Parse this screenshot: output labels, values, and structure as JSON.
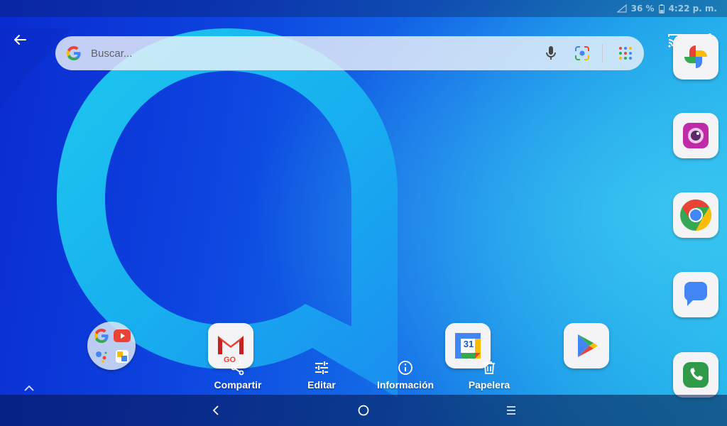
{
  "status_bar": {
    "battery_percent": "36 %",
    "time": "4:22 p. m."
  },
  "search": {
    "placeholder": "Buscar..."
  },
  "actions": {
    "share_label": "Compartir",
    "edit_label": "Editar",
    "info_label": "Información",
    "trash_label": "Papelera"
  },
  "gmail_badge": "GO",
  "calendar_day": "31",
  "icons": {
    "back": "arrow-left-icon",
    "cast": "cast-icon",
    "more": "more-vertical-icon",
    "mic": "mic-icon",
    "lens": "lens-icon",
    "apps": "apps-grid-icon"
  },
  "colors": {
    "google_blue": "#4285F4",
    "google_red": "#EA4335",
    "google_yellow": "#FBBC05",
    "google_green": "#34A853"
  }
}
